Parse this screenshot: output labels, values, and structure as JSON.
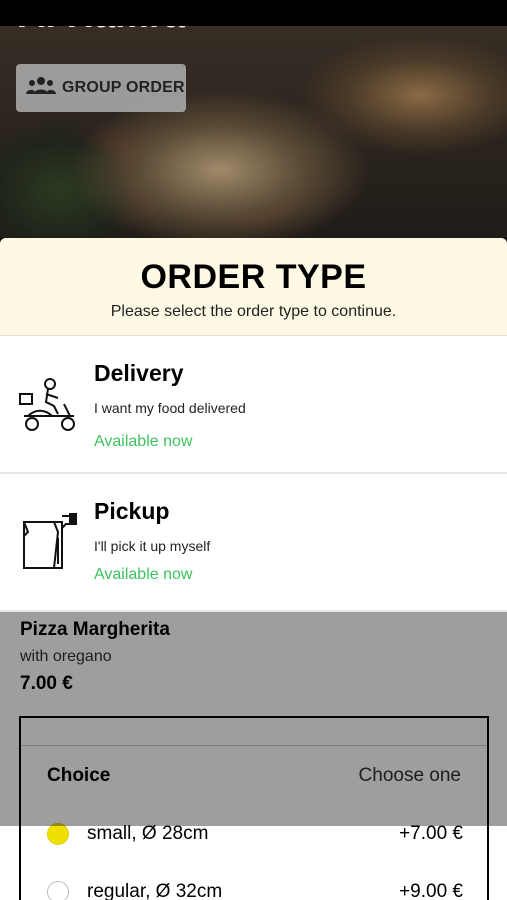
{
  "hero": {
    "restaurant_name": "Al Hamra",
    "group_order_label": "GROUP ORDER",
    "group_icon": "group-icon"
  },
  "modal": {
    "title": "ORDER TYPE",
    "subtitle": "Please select the order type to continue.",
    "options": [
      {
        "icon": "scooter-delivery-icon",
        "title": "Delivery",
        "description": "I want my food delivered",
        "availability": "Available now"
      },
      {
        "icon": "pickup-bag-icon",
        "title": "Pickup",
        "description": "I'll pick it up myself",
        "availability": "Available now"
      }
    ]
  },
  "item": {
    "name": "Pizza Margherita",
    "description": "with oregano",
    "price": "7.00 €",
    "choice": {
      "title": "Choice",
      "hint": "Choose one",
      "options": [
        {
          "name": "small, Ø 28cm",
          "price": "+7.00 €",
          "selected": true
        },
        {
          "name": "regular, Ø 32cm",
          "price": "+9.00 €",
          "selected": false
        }
      ]
    }
  },
  "colors": {
    "available": "#3ec25f",
    "modal_header_bg": "#fdf9e4",
    "radio_selected": "#f0e000"
  }
}
